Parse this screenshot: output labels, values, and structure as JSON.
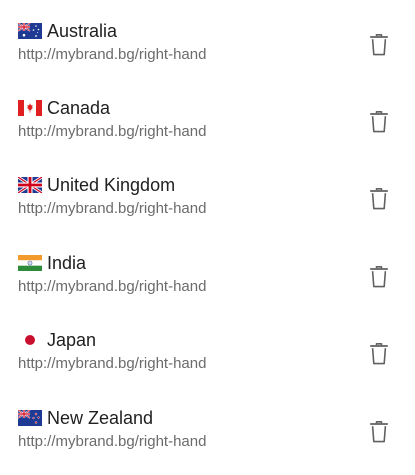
{
  "items": [
    {
      "country": "Australia",
      "flag_icon": "australia-flag-icon",
      "url": "http://mybrand.bg/right-hand",
      "delete_icon": "trash-icon"
    },
    {
      "country": "Canada",
      "flag_icon": "canada-flag-icon",
      "url": "http://mybrand.bg/right-hand",
      "delete_icon": "trash-icon"
    },
    {
      "country": "United Kingdom",
      "flag_icon": "uk-flag-icon",
      "url": "http://mybrand.bg/right-hand",
      "delete_icon": "trash-icon"
    },
    {
      "country": "India",
      "flag_icon": "india-flag-icon",
      "url": "http://mybrand.bg/right-hand",
      "delete_icon": "trash-icon"
    },
    {
      "country": "Japan",
      "flag_icon": "japan-flag-icon",
      "url": "http://mybrand.bg/right-hand",
      "delete_icon": "trash-icon"
    },
    {
      "country": "New Zealand",
      "flag_icon": "new-zealand-flag-icon",
      "url": "http://mybrand.bg/right-hand",
      "delete_icon": "trash-icon"
    }
  ],
  "colors": {
    "text_primary": "#212121",
    "text_secondary": "#6b6b6b",
    "icon": "#616161"
  }
}
